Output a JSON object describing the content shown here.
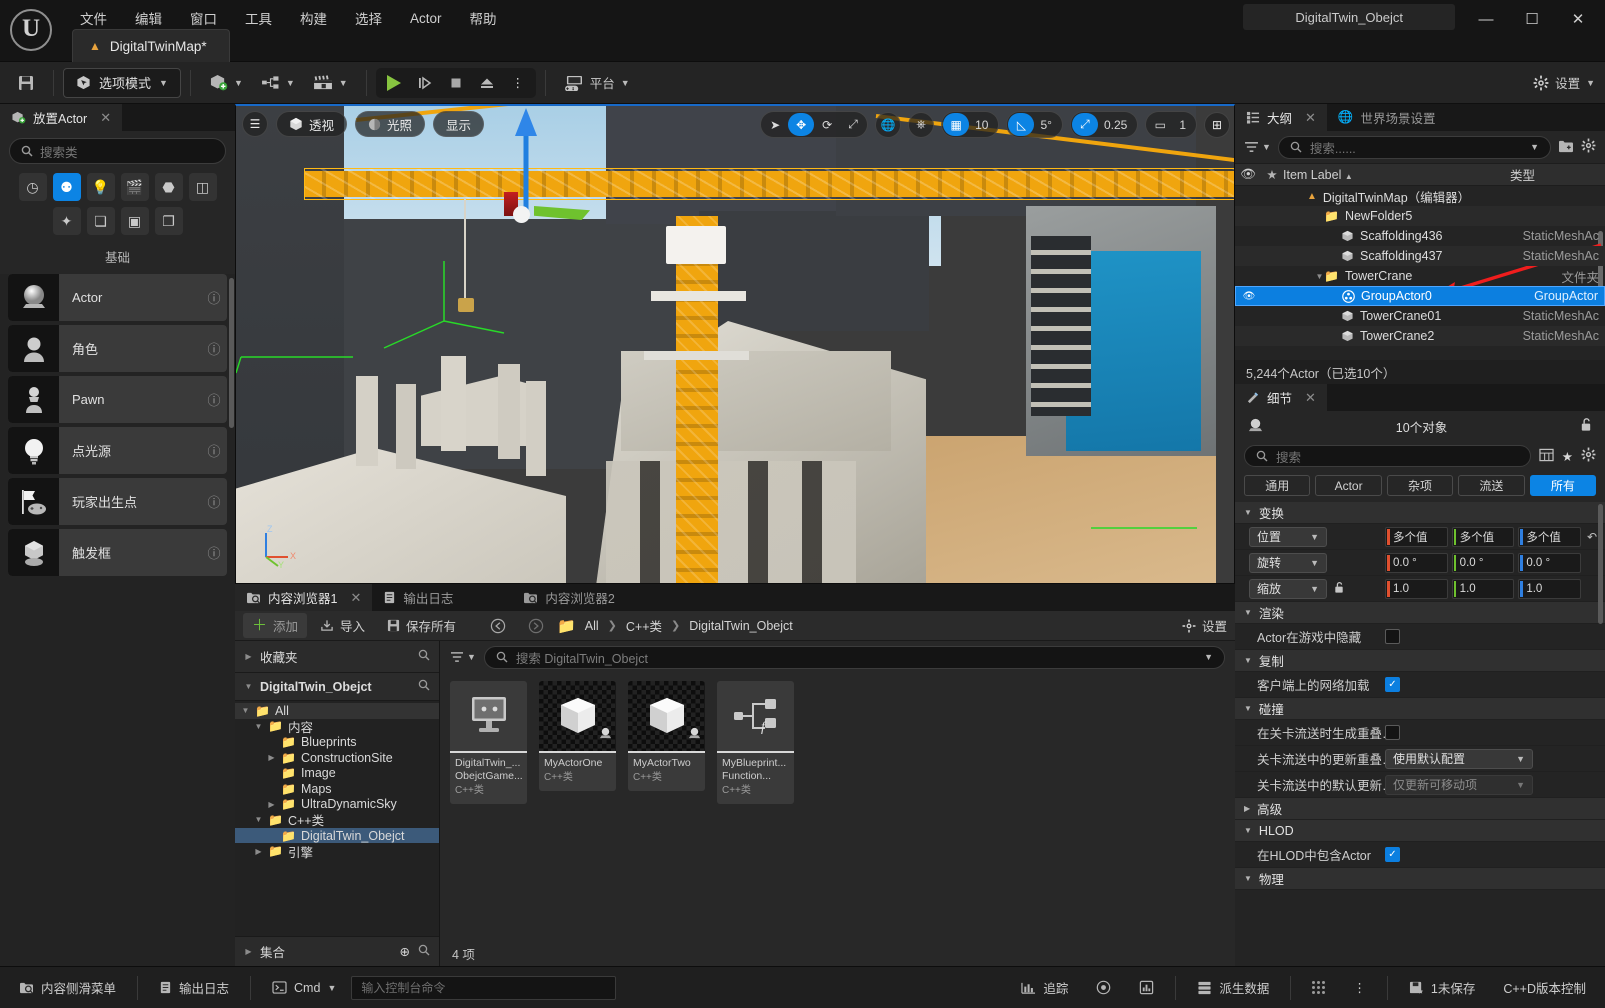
{
  "titlebar": {
    "logo": "ue-logo",
    "menus": [
      "文件",
      "编辑",
      "窗口",
      "工具",
      "构建",
      "选择",
      "Actor",
      "帮助"
    ],
    "document_tab": "DigitalTwinMap*",
    "window_title": "DigitalTwin_Obejct",
    "minimize": "—",
    "maximize": "☐",
    "close": "✕"
  },
  "toolbar": {
    "save_icon": "save-icon",
    "mode_label": "选项模式",
    "add_icon": "add-actor-icon",
    "blueprint_icon": "blueprint-icon",
    "sequencer_icon": "sequencer-icon",
    "play": "play-icon",
    "skip": "skip-icon",
    "stop": "stop-icon",
    "eject": "eject-icon",
    "more": "⋮",
    "platform_label": "平台",
    "settings_label": "设置"
  },
  "place_actors": {
    "tab_label": "放置Actor",
    "close": "✕",
    "search_placeholder": "搜索类",
    "categories": [
      "recent-icon",
      "basic-icon",
      "lights-icon",
      "cinematic-icon",
      "visual-effects-icon",
      "geometry-icon",
      "volumes-icon",
      "all-classes-icon",
      "shapes-icon",
      "panels-icon"
    ],
    "selected_category_index": 1,
    "section_label": "基础",
    "items": [
      {
        "name": "Actor",
        "icon": "sphere-thumb"
      },
      {
        "name": "角色",
        "icon": "character-thumb"
      },
      {
        "name": "Pawn",
        "icon": "pawn-thumb"
      },
      {
        "name": "点光源",
        "icon": "pointlight-thumb"
      },
      {
        "name": "玩家出生点",
        "icon": "playerstart-thumb"
      },
      {
        "name": "触发框",
        "icon": "triggerbox-thumb"
      }
    ],
    "help_icon": "?"
  },
  "viewport": {
    "menu_icon": "hamburger-icon",
    "view_mode": "透视",
    "lighting": "光照",
    "show": "显示",
    "gizmo_select": "select-icon",
    "gizmo_move": "move-icon",
    "gizmo_rotate": "rotate-icon",
    "gizmo_scale": "scale-icon",
    "world_icon": "world-space-icon",
    "surface_snap_icon": "surface-snap-icon",
    "grid_icon": "grid-snap-icon",
    "grid_value": "10",
    "angle_icon": "angle-snap-icon",
    "angle_value": "5°",
    "scale_icon": "scale-snap-icon",
    "scale_value": "0.25",
    "camera_icon": "camera-speed-icon",
    "camera_value": "1",
    "maximize_icon": "maximize-viewport-icon",
    "axis_x": "X",
    "axis_y": "Y",
    "axis_z": "Z"
  },
  "content_browser": {
    "tabs": [
      {
        "label": "内容浏览器1",
        "icon": "content-browser-icon",
        "active": true,
        "closable": true
      },
      {
        "label": "输出日志",
        "icon": "output-log-icon",
        "active": false,
        "closable": false
      },
      {
        "label": "内容浏览器2",
        "icon": "content-browser-icon",
        "active": false,
        "closable": false
      }
    ],
    "add_label": "添加",
    "import_label": "导入",
    "save_all_label": "保存所有",
    "back_icon": "back-arrow-icon",
    "forward_icon": "forward-arrow-icon",
    "breadcrumb": [
      "All",
      "C++类",
      "DigitalTwin_Obejct"
    ],
    "settings_label": "设置",
    "favorites_label": "收藏夹",
    "source_label": "DigitalTwin_Obejct",
    "tree": [
      {
        "label": "All",
        "depth": 0,
        "twist": "▼",
        "folder": true,
        "selected": false
      },
      {
        "label": "内容",
        "depth": 1,
        "twist": "▼",
        "folder": true,
        "selected": false
      },
      {
        "label": "Blueprints",
        "depth": 2,
        "twist": "",
        "folder": true,
        "selected": false
      },
      {
        "label": "ConstructionSite",
        "depth": 2,
        "twist": "▶",
        "folder": true,
        "selected": false
      },
      {
        "label": "Image",
        "depth": 2,
        "twist": "",
        "folder": true,
        "selected": false
      },
      {
        "label": "Maps",
        "depth": 2,
        "twist": "",
        "folder": true,
        "selected": false
      },
      {
        "label": "UltraDynamicSky",
        "depth": 2,
        "twist": "▶",
        "folder": true,
        "selected": false
      },
      {
        "label": "C++类",
        "depth": 1,
        "twist": "▼",
        "folder": true,
        "selected": false
      },
      {
        "label": "DigitalTwin_Obejct",
        "depth": 2,
        "twist": "",
        "folder": true,
        "selected": true
      },
      {
        "label": "引擎",
        "depth": 1,
        "twist": "▶",
        "folder": true,
        "selected": false
      }
    ],
    "collections_label": "集合",
    "search_placeholder": "搜索 DigitalTwin_Obejct",
    "assets": [
      {
        "name": "DigitalTwin_...",
        "name2": "ObejctGame...",
        "type": "C++类",
        "thumb": "gamemode-thumb"
      },
      {
        "name": "MyActorOne",
        "name2": "",
        "type": "C++类",
        "thumb": "cube-thumb"
      },
      {
        "name": "MyActorTwo",
        "name2": "",
        "type": "C++类",
        "thumb": "cube-thumb"
      },
      {
        "name": "MyBlueprint...",
        "name2": "Function...",
        "type": "C++类",
        "thumb": "blueprint-fn-thumb"
      }
    ],
    "item_count": "4 项"
  },
  "outliner": {
    "tabs": [
      {
        "label": "大纲",
        "icon": "outliner-icon",
        "active": true,
        "closable": true
      },
      {
        "label": "世界场景设置",
        "icon": "world-settings-icon",
        "active": false,
        "closable": false
      }
    ],
    "filter_icon": "filter-icon",
    "search_placeholder": "搜索......",
    "new_folder_icon": "new-folder-icon",
    "settings_icon": "gear-icon",
    "columns": {
      "visibility": "eye-icon",
      "pin": "★",
      "label": "Item Label",
      "sort": "▲",
      "type": "类型"
    },
    "rows": [
      {
        "label": "DigitalTwinMap（编辑器）",
        "type": "",
        "indent": 1,
        "icon": "level-icon",
        "selected": false,
        "twist": ""
      },
      {
        "label": "NewFolder5",
        "type": "",
        "indent": 2,
        "icon": "folder-icon",
        "selected": false,
        "twist": ""
      },
      {
        "label": "Scaffolding436",
        "type": "StaticMeshAc",
        "indent": 3,
        "icon": "mesh-icon",
        "selected": false,
        "twist": ""
      },
      {
        "label": "Scaffolding437",
        "type": "StaticMeshAc",
        "indent": 3,
        "icon": "mesh-icon",
        "selected": false,
        "twist": ""
      },
      {
        "label": "TowerCrane",
        "type": "文件夹",
        "indent": 2,
        "icon": "folder-icon",
        "selected": false,
        "twist": "▼"
      },
      {
        "label": "GroupActor0",
        "type": "GroupActor",
        "indent": 3,
        "icon": "group-icon",
        "selected": true,
        "twist": ""
      },
      {
        "label": "TowerCrane01",
        "type": "StaticMeshAc",
        "indent": 3,
        "icon": "mesh-icon",
        "selected": false,
        "twist": ""
      },
      {
        "label": "TowerCrane2",
        "type": "StaticMeshAc",
        "indent": 3,
        "icon": "mesh-icon",
        "selected": false,
        "twist": ""
      }
    ],
    "status": "5,244个Actor（已选10个）"
  },
  "details": {
    "tab_label": "细节",
    "close": "✕",
    "object_count": "10个对象",
    "lock_icon": "unlock-icon",
    "search_placeholder": "搜索",
    "column_icon": "columns-icon",
    "favorite_icon": "star-icon",
    "settings_icon": "gear-icon",
    "filters": [
      {
        "label": "通用",
        "active": false
      },
      {
        "label": "Actor",
        "active": false
      },
      {
        "label": "杂项",
        "active": false
      },
      {
        "label": "流送",
        "active": false
      },
      {
        "label": "所有",
        "active": true
      }
    ],
    "sections": [
      {
        "title": "变换",
        "expanded": true,
        "rows": [
          {
            "kind": "vector",
            "label": "位置",
            "dropdown": true,
            "lock": false,
            "x": "多个值",
            "y": "多个值",
            "z": "多个值",
            "reset": true
          },
          {
            "kind": "vector",
            "label": "旋转",
            "dropdown": true,
            "lock": false,
            "x": "0.0 °",
            "y": "0.0 °",
            "z": "0.0 °",
            "reset": false
          },
          {
            "kind": "vector",
            "label": "缩放",
            "dropdown": true,
            "lock": true,
            "x": "1.0",
            "y": "1.0",
            "z": "1.0",
            "reset": false
          }
        ]
      },
      {
        "title": "渲染",
        "expanded": true,
        "rows": [
          {
            "kind": "checkbox",
            "label": "Actor在游戏中隐藏",
            "checked": false
          }
        ]
      },
      {
        "title": "复制",
        "expanded": true,
        "rows": [
          {
            "kind": "checkbox",
            "label": "客户端上的网络加载",
            "checked": true
          }
        ]
      },
      {
        "title": "碰撞",
        "expanded": true,
        "rows": [
          {
            "kind": "checkbox",
            "label": "在关卡流送时生成重叠…",
            "checked": false
          },
          {
            "kind": "select",
            "label": "关卡流送中的更新重叠…",
            "value": "使用默认配置",
            "disabled": false
          },
          {
            "kind": "select",
            "label": "关卡流送中的默认更新…",
            "value": "仅更新可移动项",
            "disabled": true
          }
        ]
      },
      {
        "title": "高级",
        "expanded": false,
        "rows": []
      },
      {
        "title": "HLOD",
        "expanded": true,
        "rows": [
          {
            "kind": "checkbox",
            "label": "在HLOD中包含Actor",
            "checked": true
          }
        ]
      },
      {
        "title": "物理",
        "expanded": true,
        "rows": []
      }
    ]
  },
  "statusbar": {
    "content_drawer": "内容侧滑菜单",
    "output_log": "输出日志",
    "cmd_label": "Cmd",
    "cmd_placeholder": "输入控制台命令",
    "trace_label": "追踪",
    "derived_data_label": "派生数据",
    "unsaved_label": "1未保存",
    "source_control_label": "C++D版本控制",
    "more": "⋮"
  },
  "colors": {
    "accent_blue": "#0c84e4",
    "selection_blue": "#0c7fe0",
    "play_green": "#87c440",
    "crane_yellow": "#f0a50e",
    "folder_gold": "#d8a93f",
    "axis_x": "#e0502f",
    "axis_y": "#6fc22e",
    "axis_z": "#2f7fe0",
    "arrow_red": "#f01d1d"
  }
}
